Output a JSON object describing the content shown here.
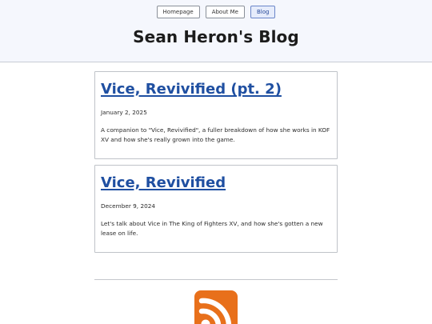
{
  "nav": {
    "items": [
      {
        "label": "Homepage",
        "active": false
      },
      {
        "label": "About Me",
        "active": false
      },
      {
        "label": "Blog",
        "active": true
      }
    ]
  },
  "site": {
    "title": "Sean Heron's Blog"
  },
  "posts": [
    {
      "title": "Vice, Revivified (pt. 2)",
      "date": "January 2, 2025",
      "excerpt": "A companion to \"Vice, Revivified\", a fuller breakdown of how she works in KOF XV and how she's really grown into the game."
    },
    {
      "title": "Vice, Revivified",
      "date": "December 9, 2024",
      "excerpt": "Let's talk about Vice in The King of Fighters XV, and how she's gotten a new lease on life."
    }
  ],
  "footer": {
    "rss_icon": "rss-feed-icon",
    "rss_color": "#e8701b"
  }
}
